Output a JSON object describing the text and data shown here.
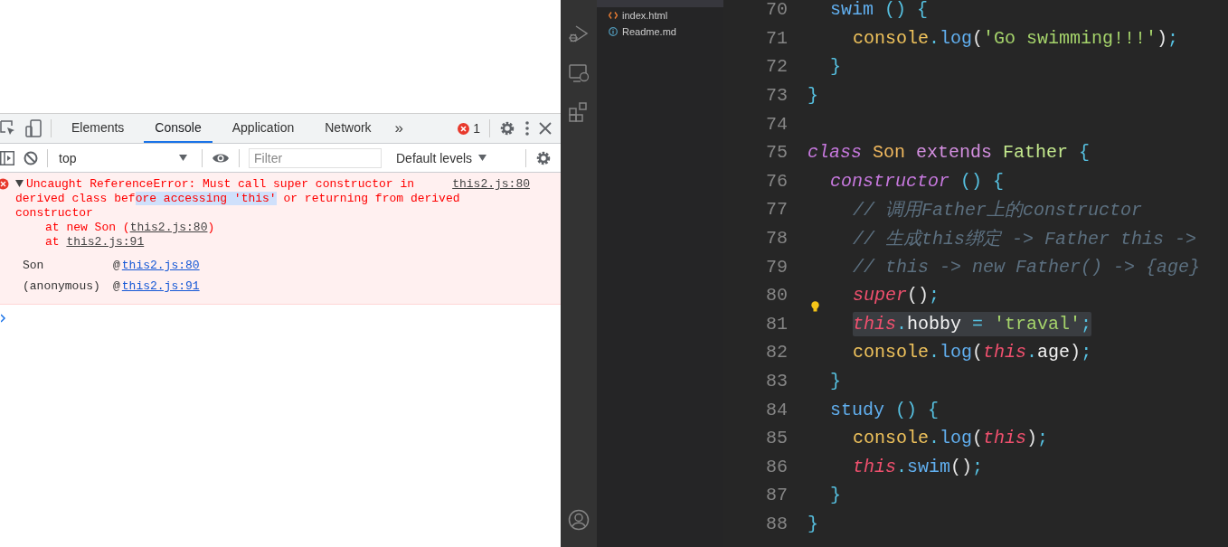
{
  "devtools": {
    "tabs": [
      {
        "label": "Elements",
        "selected": false
      },
      {
        "label": "Console",
        "selected": true
      },
      {
        "label": "Application",
        "selected": false
      },
      {
        "label": "Network",
        "selected": false
      }
    ],
    "more_tabs": "»",
    "error_count": "1",
    "context": "top",
    "filter": {
      "placeholder": "Filter"
    },
    "levels": "Default levels",
    "error": {
      "expanded": true,
      "message": [
        {
          "text": "Uncaught ReferenceError: Must call super constructor in derived class bef",
          "selected": false
        },
        {
          "text": "ore accessing 'this'",
          "selected": true
        },
        {
          "text": " or returning from derived constructor",
          "selected": false
        }
      ],
      "source": "this2.js:80",
      "stack": [
        {
          "prefix": "at new Son (",
          "link": "this2.js:80",
          "suffix": ")"
        },
        {
          "prefix": "at ",
          "link": "this2.js:91"
        }
      ],
      "frames": [
        {
          "name": "Son",
          "at": "@",
          "link": "this2.js:80"
        },
        {
          "name": "(anonymous)",
          "at": "@",
          "link": "this2.js:91"
        }
      ]
    }
  },
  "editor": {
    "files": [
      {
        "name": "index.html",
        "kind": "html"
      },
      {
        "name": "Readme.md",
        "kind": "info"
      }
    ],
    "lines": [
      {
        "number": "70",
        "tokens": [
          {
            "kind": "fn",
            "text": "swim"
          },
          {
            "kind": "punc",
            "text": " () {"
          }
        ],
        "children": [
          {
            "number": "71",
            "tokens": [
              {
                "kind": "obj",
                "text": "console"
              },
              {
                "kind": "punc",
                "text": "."
              },
              {
                "kind": "fn",
                "text": "log"
              },
              {
                "kind": "plain",
                "text": "("
              },
              {
                "kind": "str",
                "text": "'Go swimming!!!'"
              },
              {
                "kind": "plain",
                "text": ")"
              },
              {
                "kind": "punc",
                "text": ";"
              }
            ]
          }
        ]
      },
      {
        "number": "72",
        "tokens": [
          {
            "kind": "punc",
            "text": "}"
          }
        ]
      }
    ],
    "top": [
      {
        "number": "73",
        "tokens": [
          {
            "kind": "punc",
            "text": "}"
          }
        ]
      },
      {
        "number": "74"
      },
      {
        "number": "75",
        "tokens": [
          {
            "kind": "kw",
            "text": "class"
          },
          {
            "kind": "cls",
            "text": " Son"
          },
          {
            "kind": "ext",
            "text": " extends"
          },
          {
            "kind": "base",
            "text": " Father"
          },
          {
            "kind": "punc",
            "text": " {"
          }
        ],
        "children": [
          {
            "number": "76",
            "tokens": [
              {
                "kind": "kw",
                "text": "constructor"
              },
              {
                "kind": "punc",
                "text": " () {"
              }
            ],
            "children": [
              {
                "number": "77",
                "tokens": [
                  {
                    "kind": "comment",
                    "text": "// 调用Father上的constructor"
                  }
                ]
              },
              {
                "number": "78",
                "tokens": [
                  {
                    "kind": "comment",
                    "text": "// 生成this绑定 -> Father this ->"
                  }
                ]
              },
              {
                "number": "79",
                "tokens": [
                  {
                    "kind": "comment",
                    "text": "// this -> new Father() -> {age}"
                  }
                ]
              },
              {
                "number": "80",
                "tokens": [
                  {
                    "kind": "this",
                    "text": "super"
                  },
                  {
                    "kind": "plain",
                    "text": "()"
                  },
                  {
                    "kind": "punc",
                    "text": ";"
                  }
                ]
              },
              {
                "number": "81",
                "highlighted": true,
                "hint": true,
                "tokens": [
                  {
                    "kind": "this",
                    "text": "this"
                  },
                  {
                    "kind": "punc",
                    "text": "."
                  },
                  {
                    "kind": "prop",
                    "text": "hobby"
                  },
                  {
                    "kind": "punc",
                    "text": " = "
                  },
                  {
                    "kind": "str",
                    "text": "'traval'"
                  },
                  {
                    "kind": "punc",
                    "text": ";"
                  }
                ]
              },
              {
                "number": "82",
                "tokens": [
                  {
                    "kind": "obj",
                    "text": "console"
                  },
                  {
                    "kind": "punc",
                    "text": "."
                  },
                  {
                    "kind": "fn",
                    "text": "log"
                  },
                  {
                    "kind": "plain",
                    "text": "("
                  },
                  {
                    "kind": "this",
                    "text": "this"
                  },
                  {
                    "kind": "punc",
                    "text": "."
                  },
                  {
                    "kind": "prop",
                    "text": "age"
                  },
                  {
                    "kind": "plain",
                    "text": ")"
                  },
                  {
                    "kind": "punc",
                    "text": ";"
                  }
                ]
              }
            ]
          },
          {
            "number": "83",
            "tokens": [
              {
                "kind": "punc",
                "text": "}"
              }
            ]
          },
          {
            "number": "84",
            "tokens": [
              {
                "kind": "fn",
                "text": "study"
              },
              {
                "kind": "punc",
                "text": " () {"
              }
            ],
            "children": [
              {
                "number": "85",
                "tokens": [
                  {
                    "kind": "obj",
                    "text": "console"
                  },
                  {
                    "kind": "punc",
                    "text": "."
                  },
                  {
                    "kind": "fn",
                    "text": "log"
                  },
                  {
                    "kind": "plain",
                    "text": "("
                  },
                  {
                    "kind": "this",
                    "text": "this"
                  },
                  {
                    "kind": "plain",
                    "text": ")"
                  },
                  {
                    "kind": "punc",
                    "text": ";"
                  }
                ]
              },
              {
                "number": "86",
                "tokens": [
                  {
                    "kind": "this",
                    "text": "this"
                  },
                  {
                    "kind": "punc",
                    "text": "."
                  },
                  {
                    "kind": "fn",
                    "text": "swim"
                  },
                  {
                    "kind": "plain",
                    "text": "()"
                  },
                  {
                    "kind": "punc",
                    "text": ";"
                  }
                ]
              }
            ]
          },
          {
            "number": "87",
            "tokens": [
              {
                "kind": "punc",
                "text": "}"
              }
            ]
          }
        ]
      },
      {
        "number": "88",
        "tokens": [
          {
            "kind": "punc",
            "text": "}"
          }
        ]
      }
    ]
  }
}
